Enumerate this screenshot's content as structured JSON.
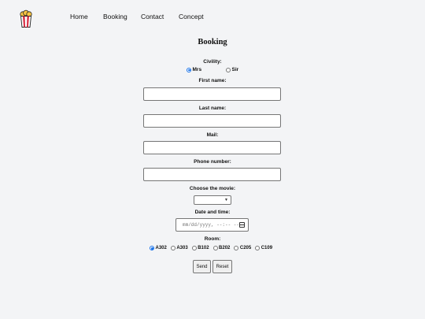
{
  "nav": {
    "items": [
      "Home",
      "Booking",
      "Contact",
      "Concept"
    ]
  },
  "form": {
    "title": "Booking",
    "civility_label": "Civility:",
    "civility_options": [
      "Mrs",
      "Sir"
    ],
    "civility_selected": "Mrs",
    "first_name_label": "First name:",
    "last_name_label": "Last name:",
    "mail_label": "Mail:",
    "phone_label": "Phone number:",
    "movie_label": "Choose the movie:",
    "datetime_label": "Date and time:",
    "datetime_placeholder": "mm/dd/yyyy, --:-- --",
    "room_label": "Room:",
    "room_options": [
      "A302",
      "A303",
      "B102",
      "B202",
      "C205",
      "C109"
    ],
    "room_selected": "A302",
    "send_label": "Send",
    "reset_label": "Reset"
  },
  "colors": {
    "background": "#f3f4f6",
    "radio_accent": "#1a73e8",
    "logo_red": "#d7263d",
    "logo_yellow": "#f6c344"
  },
  "icons": {
    "logo": "popcorn-icon"
  }
}
